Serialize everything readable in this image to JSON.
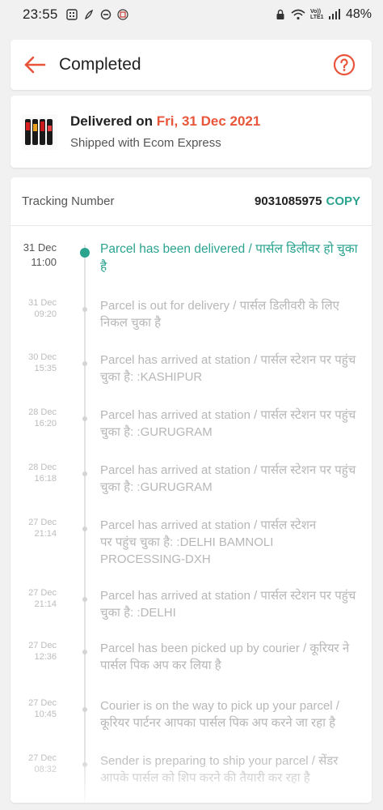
{
  "status_bar": {
    "time": "23:55",
    "battery": "48%",
    "network_label": "Vo)) LTE1",
    "icons": [
      "gallery-icon",
      "leaf-icon",
      "minus-circle-icon",
      "calendar-icon",
      "lock-icon",
      "wifi-icon",
      "signal-icon"
    ]
  },
  "header": {
    "title": "Completed",
    "back_icon": "arrow-left-icon",
    "help_icon": "question-circle-icon",
    "accent_color": "#e8553a"
  },
  "delivery": {
    "delivered_prefix": "Delivered on",
    "delivered_date": "Fri, 31 Dec 2021",
    "shipped_text": "Shipped with Ecom Express"
  },
  "tracking": {
    "label": "Tracking Number",
    "number": "9031085975",
    "copy_label": "COPY",
    "accent_color": "#2aa38f"
  },
  "events": [
    {
      "date": "31 Dec",
      "time": "11:00",
      "text": "Parcel has been delivered / पार्सल डिलीवर हो चुका है"
    },
    {
      "date": "31 Dec",
      "time": "09:20",
      "text": "Parcel is out for delivery / पार्सल डिलीवरी के लिए निकल चुका है"
    },
    {
      "date": "30 Dec",
      "time": "15:35",
      "text": "Parcel has arrived at station / पार्सल स्टेशन पर पहुंच चुका है: :KASHIPUR"
    },
    {
      "date": "28 Dec",
      "time": "16:20",
      "text": "Parcel has arrived at station / पार्सल स्टेशन पर पहुंच चुका है: :GURUGRAM"
    },
    {
      "date": "28 Dec",
      "time": "16:18",
      "text": "Parcel has arrived at station / पार्सल स्टेशन पर पहुंच चुका है: :GURUGRAM"
    },
    {
      "date": "27 Dec",
      "time": "21:14",
      "text": "Parcel has arrived at station / पार्सल स्टेशन पर पहुंच चुका है: :DELHI BAMNOLI PROCESSING-DXH"
    },
    {
      "date": "27 Dec",
      "time": "21:14",
      "text": "Parcel has arrived at station / पार्सल स्टेशन पर पहुंच चुका है: :DELHI"
    },
    {
      "date": "27 Dec",
      "time": "12:36",
      "text": "Parcel has been picked up by courier / कूरियर ने पार्सल पिक अप कर लिया है"
    },
    {
      "date": "27 Dec",
      "time": "10:45",
      "text": "Courier is on the way to pick up your parcel / कूरियर पार्टनर आपका पार्सल पिक अप करने जा रहा है"
    },
    {
      "date": "27 Dec",
      "time": "08:32",
      "text": "Sender is preparing to ship your parcel / सेंडर आपके पार्सल को शिप करने की तैयारी कर रहा है"
    }
  ]
}
